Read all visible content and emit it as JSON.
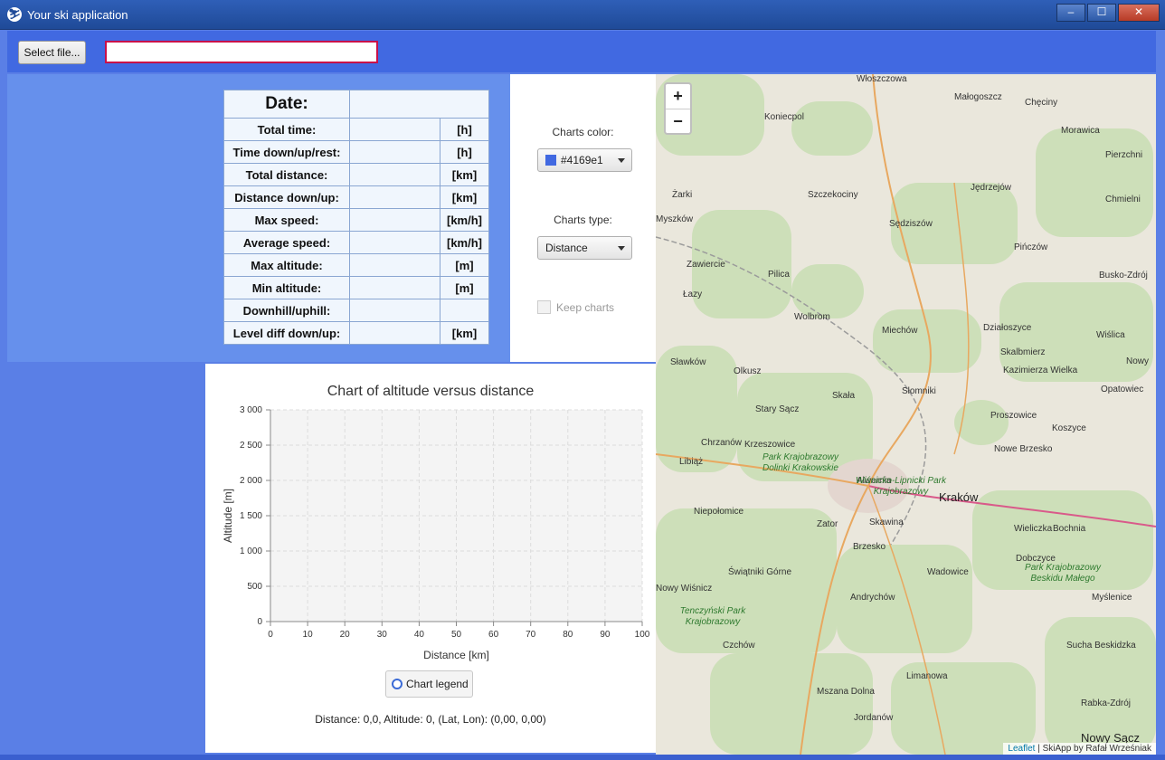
{
  "window": {
    "title": "Your ski application",
    "minimize": "‒",
    "maximize": "☐",
    "close": "✕",
    "app_icon": "skier-icon"
  },
  "toolbar": {
    "select_file_label": "Select file...",
    "file_path_value": ""
  },
  "stats": {
    "date_label": "Date:",
    "rows": [
      {
        "label": "Total time:",
        "value": "",
        "unit": "[h]"
      },
      {
        "label": "Time down/up/rest:",
        "value": "",
        "unit": "[h]"
      },
      {
        "label": "Total distance:",
        "value": "",
        "unit": "[km]"
      },
      {
        "label": "Distance down/up:",
        "value": "",
        "unit": "[km]"
      },
      {
        "label": "Max speed:",
        "value": "",
        "unit": "[km/h]"
      },
      {
        "label": "Average speed:",
        "value": "",
        "unit": "[km/h]"
      },
      {
        "label": "Max altitude:",
        "value": "",
        "unit": "[m]"
      },
      {
        "label": "Min altitude:",
        "value": "",
        "unit": "[m]"
      },
      {
        "label": "Downhill/uphill:",
        "value": "",
        "unit": ""
      },
      {
        "label": "Level diff down/up:",
        "value": "",
        "unit": "[km]"
      }
    ]
  },
  "controls": {
    "charts_color_label": "Charts color:",
    "charts_color_value": "#4169e1",
    "charts_type_label": "Charts type:",
    "charts_type_value": "Distance",
    "keep_charts_label": "Keep charts",
    "keep_charts_checked": false
  },
  "chart_data": {
    "type": "line",
    "title": "Chart of altitude versus distance",
    "xlabel": "Distance [km]",
    "ylabel": "Altitude [m]",
    "xlim": [
      0,
      100
    ],
    "ylim": [
      0,
      3000
    ],
    "x_ticks": [
      "0",
      "10",
      "20",
      "30",
      "40",
      "50",
      "60",
      "70",
      "80",
      "90",
      "100"
    ],
    "y_ticks": [
      "0",
      "500",
      "1 000",
      "1 500",
      "2 000",
      "2 500",
      "3 000"
    ],
    "grid": true,
    "series": []
  },
  "legend": {
    "label": "Chart legend"
  },
  "status": {
    "text": "Distance: 0,0, Altitude: 0, (Lat, Lon): (0,00, 0,00)"
  },
  "map": {
    "zoom_in": "+",
    "zoom_out": "−",
    "attribution_link": "Leaflet",
    "attribution_text": " | SkiApp by Rafał Wrześniak",
    "places": [
      "Włoszczowa",
      "Małogoszcz",
      "Chęciny",
      "Koniecpol",
      "Morawica",
      "Pierzchni",
      "Żarki",
      "Szczekociny",
      "Jędrzejów",
      "Chmielni",
      "Myszków",
      "Sędziszów",
      "Pińczów",
      "Zawiercie",
      "Pilica",
      "Busko-Zdrój",
      "Łazy",
      "Wolbrom",
      "Miechów",
      "Działoszyce",
      "Wiślica",
      "Skalbmierz",
      "Sławków",
      "Olkusz",
      "Kazimierza Wielka",
      "Nowy",
      "Opatowiec",
      "Skała",
      "Słomniki",
      "Proszowice",
      "Koszyce",
      "Chrzanów",
      "Krzeszowice",
      "Nowe Brzesko",
      "Libiąż",
      "Alwernia",
      "Kraków",
      "Niepołomice",
      "Zator",
      "Skawina",
      "Wieliczka",
      "Bochnia",
      "Brzesko",
      "Świątniki Górne",
      "Wadowice",
      "Dobczyce",
      "Nowy Wiśnicz",
      "Andrychów",
      "Myślenice",
      "Czchów",
      "Sucha Beskidzka",
      "Limanowa",
      "Mszana Dolna",
      "Jordanów",
      "Rabka-Zdrój",
      "Nowy Sącz",
      "Stary Sącz",
      "Park Krajobrazowy Dolinki Krakowskie",
      "Tenczyński Park Krajobrazowy",
      "Park Krajobrazowy Beskidu Małego",
      "Wiśnicko-Lipnicki Park Krajobrazowy",
      "Kraków"
    ]
  }
}
